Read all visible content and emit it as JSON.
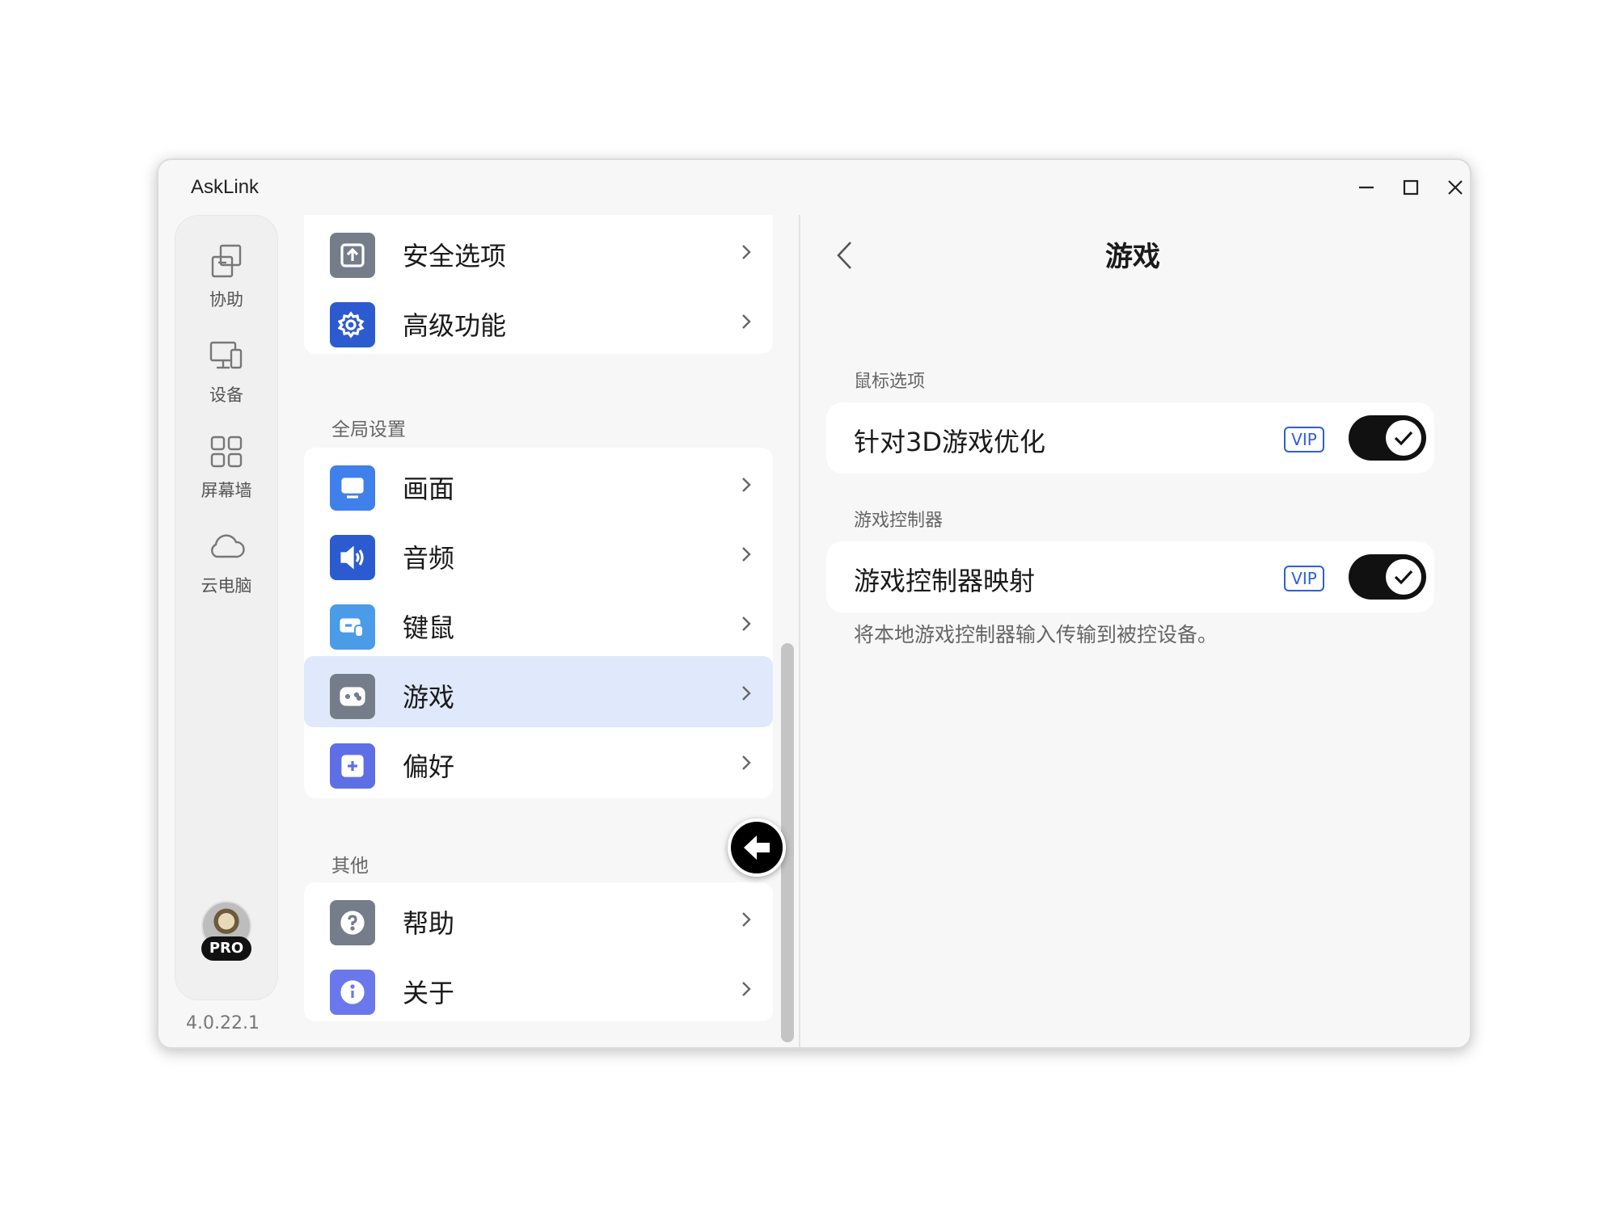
{
  "window": {
    "title": "AskLink",
    "controls": [
      "minimize-icon",
      "maximize-icon",
      "close-icon"
    ]
  },
  "nav": {
    "items": [
      {
        "label": "协助",
        "icon": "assist-icon"
      },
      {
        "label": "设备",
        "icon": "devices-icon"
      },
      {
        "label": "屏幕墙",
        "icon": "screen-wall-icon"
      },
      {
        "label": "云电脑",
        "icon": "cloud-pc-icon"
      }
    ],
    "badge": "PRO",
    "version": "4.0.22.1"
  },
  "settings_list": {
    "top_items": [
      {
        "label": "安全选项",
        "icon": "upload-shield-icon",
        "color": "#757d8a"
      },
      {
        "label": "高级功能",
        "icon": "gear-sparkle-icon",
        "color": "#2b5bcf"
      }
    ],
    "global_section": {
      "label": "全局设置",
      "items": [
        {
          "label": "画面",
          "icon": "monitor-icon",
          "color": "#3f80ea"
        },
        {
          "label": "音频",
          "icon": "speaker-icon",
          "color": "#2b5bcf"
        },
        {
          "label": "键鼠",
          "icon": "keyboard-mouse-icon",
          "color": "#4a9be8"
        },
        {
          "label": "游戏",
          "icon": "gamepad-icon",
          "color": "#757d8a",
          "selected": true
        },
        {
          "label": "偏好",
          "icon": "plus-square-icon",
          "color": "#5e6fe6"
        }
      ]
    },
    "other_section": {
      "label": "其他",
      "items": [
        {
          "label": "帮助",
          "icon": "help-icon",
          "color": "#757d8a"
        },
        {
          "label": "关于",
          "icon": "info-icon",
          "color": "#6a78ec"
        }
      ]
    }
  },
  "detail": {
    "title": "游戏",
    "back_icon": "chevron-left-icon",
    "mouse_section": {
      "label": "鼠标选项",
      "setting": {
        "label": "针对3D游戏优化",
        "tag": "VIP",
        "enabled": true
      }
    },
    "controller_section": {
      "label": "游戏控制器",
      "setting": {
        "label": "游戏控制器映射",
        "tag": "VIP",
        "enabled": true
      },
      "description": "将本地游戏控制器输入传输到被控设备。"
    }
  },
  "colors": {
    "accent": "#2d5fd9",
    "selected_row": "#dfe9fb",
    "toggle_on": "#111111"
  }
}
